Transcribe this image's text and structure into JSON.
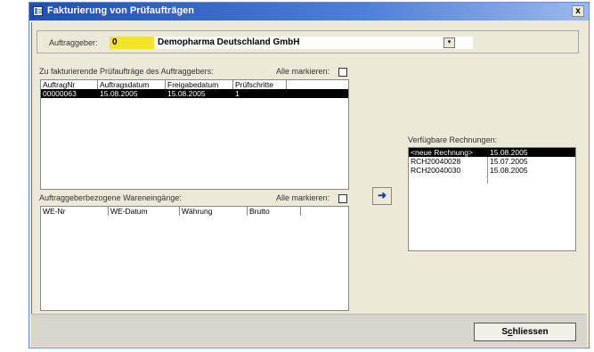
{
  "window": {
    "title": "Fakturierung von Prüfaufträgen",
    "close_glyph": "x"
  },
  "header": {
    "client_label": "Auftraggeber:",
    "client_code": "0",
    "client_name": "Demopharma Deutschland GmbH",
    "dropdown_glyph": "▾"
  },
  "orders": {
    "caption": "Zu fakturierende Prüfaufträge des Auftraggebers:",
    "mark_all_label": "Alle markieren:",
    "columns": [
      "AuftragNr",
      "Auftragsdatum",
      "Freigabedatum",
      "Prüfschritte"
    ],
    "rows": [
      {
        "nr": "00000063",
        "auftragsdatum": "15.08.2005",
        "freigabedatum": "15.08.2005",
        "pruefschritte": "1",
        "selected": true
      }
    ]
  },
  "receipts": {
    "caption": "Auftraggeberbezogene Wareneingänge:",
    "mark_all_label": "Alle markieren:",
    "columns": [
      "WE-Nr",
      "WE-Datum",
      "Währung",
      "Brutto"
    ],
    "rows": []
  },
  "transfer_button": {
    "glyph": "➜",
    "icon": "arrow-right-icon"
  },
  "invoices": {
    "caption": "Verfügbare Rechnungen:",
    "rows": [
      {
        "name": "<neue Rechnung>",
        "date": "15.08.2005",
        "selected": true
      },
      {
        "name": "RCH20040028",
        "date": "15.07.2005",
        "selected": false
      },
      {
        "name": "RCH20040030",
        "date": "15.08.2005",
        "selected": false
      }
    ]
  },
  "footer": {
    "close_prefix": "S",
    "close_underlined": "c",
    "close_suffix": "hliessen"
  }
}
